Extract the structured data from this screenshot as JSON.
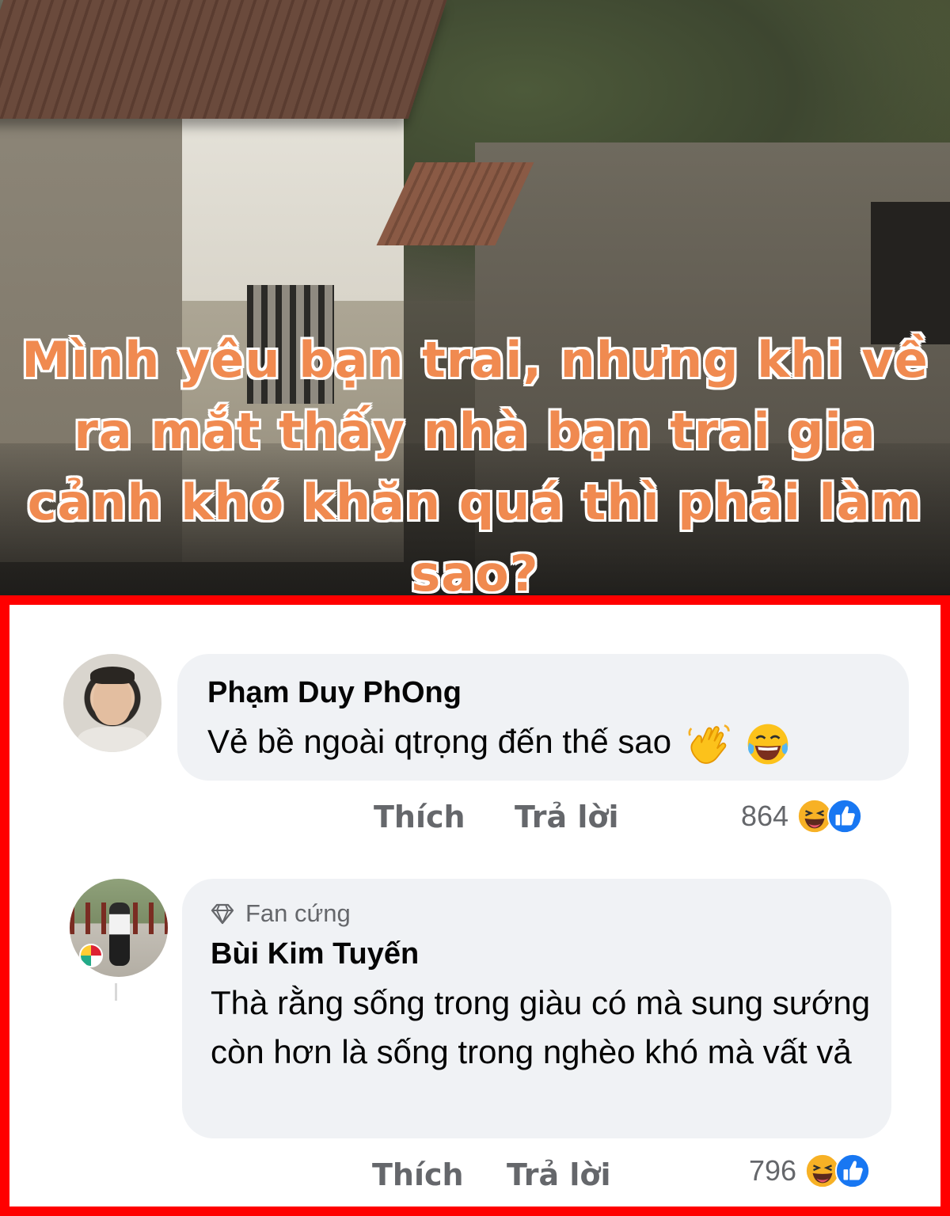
{
  "headline": "Mình yêu bạn trai, nhưng khi về ra mắt thấy nhà bạn trai gia cảnh khó khăn quá thì phải làm sao?",
  "colors": {
    "headline": "#f08a50",
    "frame": "#ff0000",
    "bubble": "#f0f2f5",
    "action_text": "#65676b",
    "like_blue": "#1877f2",
    "haha_yellow": "#f7b125"
  },
  "comments": [
    {
      "author": "Phạm Duy PhOng",
      "badge": null,
      "text": "Vẻ bề ngoài qtrọng đến thế sao",
      "inline_emojis": [
        "waving-hand-emoji",
        "tears-of-joy-emoji"
      ],
      "actions": {
        "like": "Thích",
        "reply": "Trả lời"
      },
      "reaction_count": "864",
      "reaction_icons": [
        "haha-reaction-icon",
        "like-reaction-icon"
      ]
    },
    {
      "author": "Bùi Kim Tuyến",
      "badge": "Fan cứng",
      "badge_icon": "diamond-icon",
      "text": "Thà rằng sống trong giàu có mà sung sướng còn hơn là sống trong nghèo khó mà vất vả",
      "actions": {
        "like": "Thích",
        "reply": "Trả lời"
      },
      "reaction_count": "796",
      "reaction_icons": [
        "haha-reaction-icon",
        "like-reaction-icon"
      ]
    }
  ]
}
